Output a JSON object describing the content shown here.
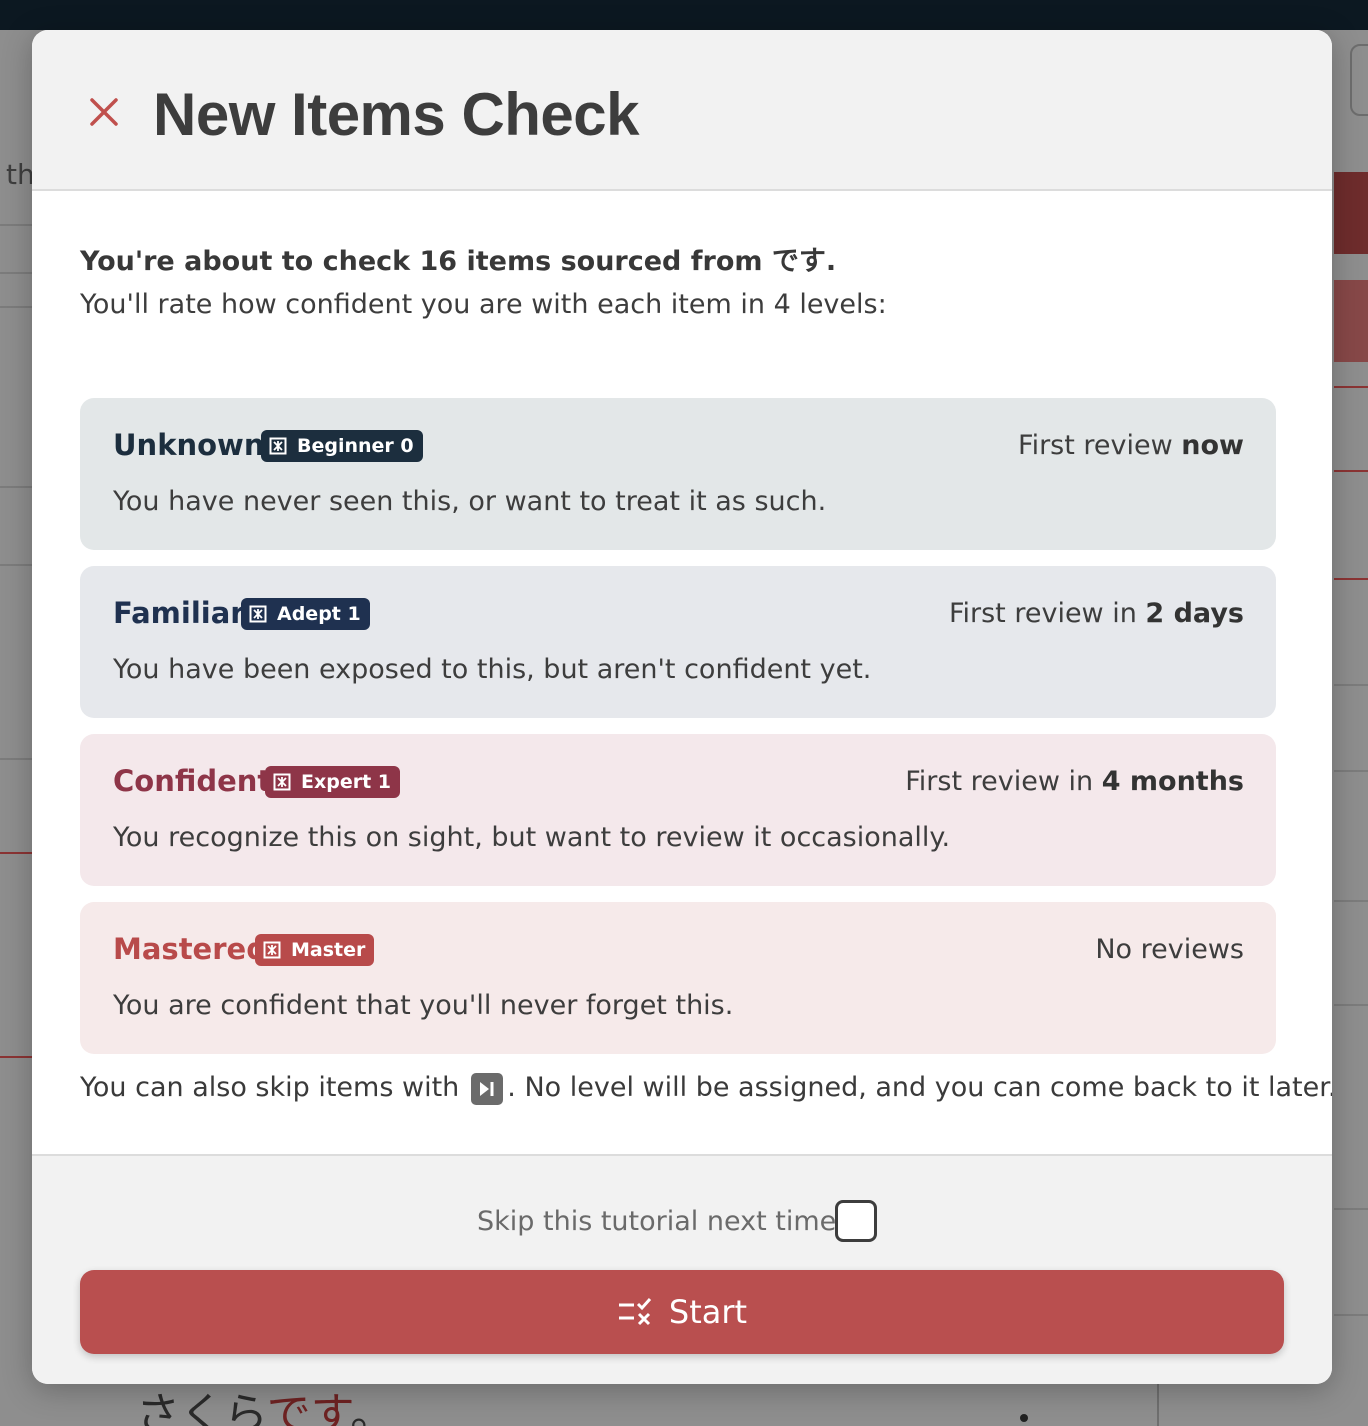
{
  "background": {
    "left_fragment": "th",
    "bottom_text_plain": "さくら",
    "bottom_text_highlight": "です",
    "bottom_text_end": "。"
  },
  "modal": {
    "title": "New Items Check",
    "close_icon": "close-icon",
    "intro_bold": "You're about to check 16 items sourced from です.",
    "intro_sub": "You'll rate how confident you are with each item in 4 levels:",
    "levels": [
      {
        "name": "Unknown",
        "badge": "Beginner 0",
        "review_prefix": "First review ",
        "review_value": "now",
        "description": "You have never seen this, or want to treat it as such.",
        "name_color": "#1c2e3e",
        "badge_color": "#1c2e3e",
        "bg_color": "#e3e7e8"
      },
      {
        "name": "Familiar",
        "badge": "Adept 1",
        "review_prefix": "First review in ",
        "review_value": "2 days",
        "description": "You have been exposed to this, but aren't confident yet.",
        "name_color": "#1f3150",
        "badge_color": "#1f3150",
        "bg_color": "#e6e8ec"
      },
      {
        "name": "Confident",
        "badge": "Expert 1",
        "review_prefix": "First review in ",
        "review_value": "4 months",
        "description": "You recognize this on sight, but want to review it occasionally.",
        "name_color": "#8e3548",
        "badge_color": "#8e3548",
        "bg_color": "#f4e8eb"
      },
      {
        "name": "Mastered",
        "badge": "Master",
        "review_prefix": "No reviews",
        "review_value": "",
        "description": "You are confident that you'll never forget this.",
        "name_color": "#b84a4a",
        "badge_color": "#b84a4a",
        "bg_color": "#f6eaea"
      }
    ],
    "skip_note_before": "You can also skip items with",
    "skip_note_after": ". No level will be assigned, and you can come back to it later.",
    "skip_icon": "skip-forward-icon",
    "footer": {
      "skip_tutorial_label": "Skip this tutorial next time",
      "start_label": "Start",
      "start_icon": "checklist-icon"
    }
  }
}
